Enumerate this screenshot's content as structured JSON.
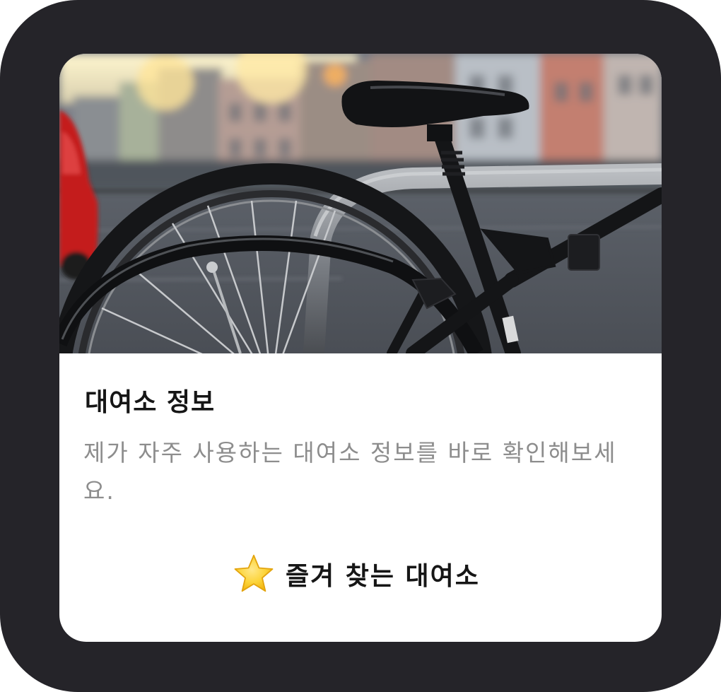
{
  "widget": {
    "hero_image": {
      "alt": "",
      "icon": "bicycle-photo"
    },
    "title": "대여소 정보",
    "description": "제가 자주 사용하는 대여소 정보를 바로 확인해보세요.",
    "favorite_button": {
      "icon": "star-icon",
      "label": "즐겨 찾는 대여소"
    }
  },
  "colors": {
    "frame": "#252429",
    "card": "#ffffff",
    "title": "#161616",
    "description": "#8d8d8d",
    "star": "#f7c21e"
  }
}
